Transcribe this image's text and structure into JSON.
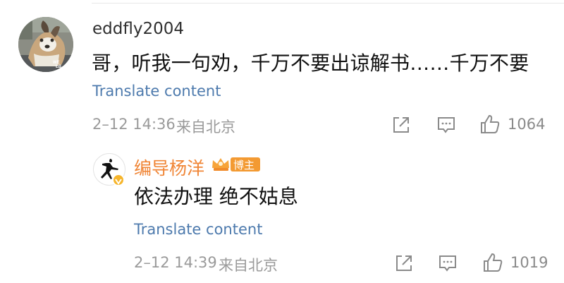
{
  "comment": {
    "username": "eddfly2004",
    "text": "哥，听我一句劝，千万不要出谅解书……千万不要",
    "translate_label": "Translate content",
    "timestamp": "2–12 14:36",
    "location": "来自北京",
    "like_count": "1064"
  },
  "reply": {
    "username": "编导杨洋",
    "badge_label": "博主",
    "text": "依法办理 绝不姑息",
    "translate_label": "Translate content",
    "timestamp": "2–12 14:39",
    "location": "来自北京",
    "like_count": "1019"
  },
  "icons": {
    "share": "share-icon",
    "comment": "comment-icon",
    "like": "like-icon",
    "verified": "verified-badge-icon",
    "crown": "crown-badge-icon"
  },
  "colors": {
    "link": "#4d7aad",
    "username_primary": "#2f2f2f",
    "username_blogger": "#f08535",
    "meta": "#9a9a9a",
    "badge": "#f7a43a",
    "verified": "#f6b52b"
  }
}
